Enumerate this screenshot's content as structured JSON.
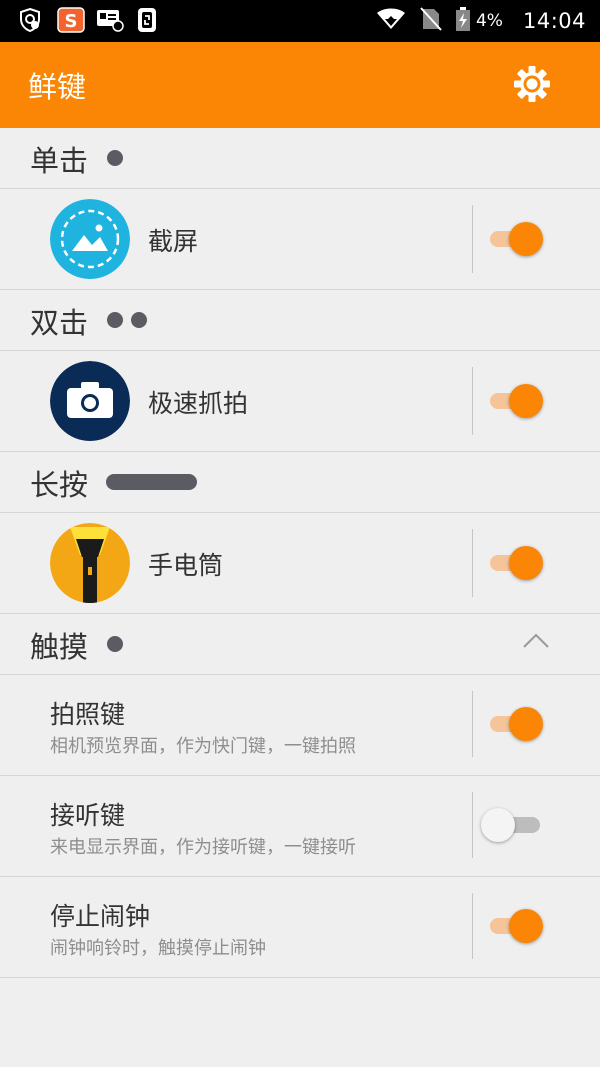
{
  "statusbar": {
    "battery": "4%",
    "time": "14:04"
  },
  "appbar": {
    "title": "鲜键",
    "settings_icon": "gear-icon"
  },
  "sections": {
    "single": {
      "label": "单击"
    },
    "double": {
      "label": "双击"
    },
    "long": {
      "label": "长按"
    },
    "touch": {
      "label": "触摸"
    }
  },
  "actions": {
    "screenshot": {
      "label": "截屏",
      "enabled": true
    },
    "camera": {
      "label": "极速抓拍",
      "enabled": true
    },
    "flashlight": {
      "label": "手电筒",
      "enabled": true
    }
  },
  "touch_items": [
    {
      "title": "拍照键",
      "subtitle": "相机预览界面，作为快门键，一键拍照",
      "enabled": true
    },
    {
      "title": "接听键",
      "subtitle": "来电显示界面，作为接听键，一键接听",
      "enabled": false
    },
    {
      "title": "停止闹钟",
      "subtitle": "闹钟响铃时，触摸停止闹钟",
      "enabled": true
    }
  ],
  "colors": {
    "accent": "#fb8505",
    "background": "#efefef",
    "dot": "#5b5b63"
  }
}
